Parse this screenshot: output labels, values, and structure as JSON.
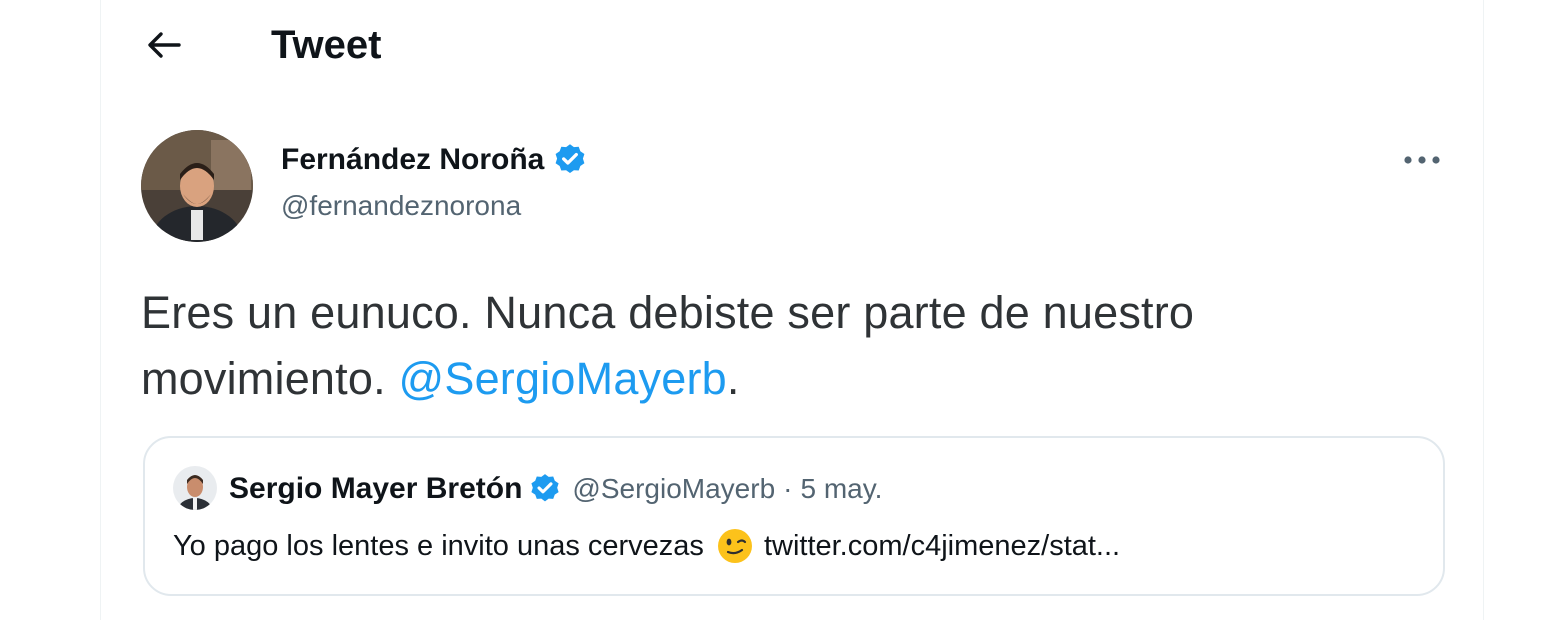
{
  "header": {
    "title": "Tweet"
  },
  "tweet": {
    "author_name": "Fernández Noroña",
    "author_handle": "@fernandeznorona",
    "text_part1": "Eres un eunuco. Nunca debiste ser parte de nuestro movimiento.",
    "mention": "@SergioMayerb",
    "text_part2": "."
  },
  "quoted_tweet": {
    "author_name": "Sergio Mayer Bretón",
    "author_handle": "@SergioMayerb",
    "separator": "·",
    "date": "5 may.",
    "text": "Yo pago los lentes e invito unas cervezas",
    "emoji": "winking-face",
    "link": "twitter.com/c4jimenez/stat..."
  },
  "colors": {
    "accent": "#1d9bf0",
    "secondary_text": "#536471",
    "border": "#e1e8ed"
  }
}
